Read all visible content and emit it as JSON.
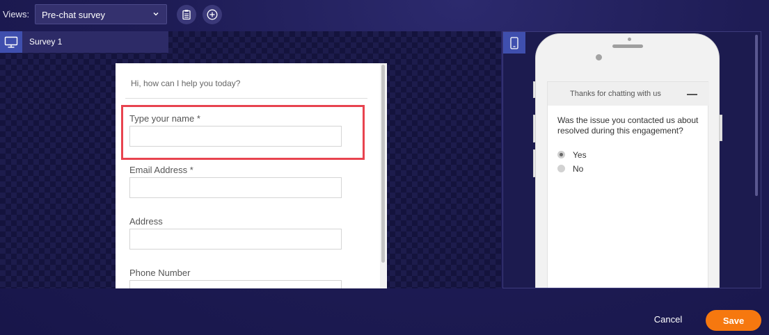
{
  "toolbar": {
    "views_label": "Views:",
    "views_selected": "Pre-chat survey"
  },
  "left_panel": {
    "tab_label": "Survey 1",
    "survey": {
      "greeting": "Hi, how can I help you today?",
      "fields": [
        {
          "label": "Type your name *"
        },
        {
          "label": "Email Address *"
        },
        {
          "label": "Address"
        },
        {
          "label": "Phone Number"
        }
      ]
    }
  },
  "right_panel": {
    "preview": {
      "header_title": "Thanks for chatting with us",
      "question": "Was the issue you contacted us about resolved during this engagement?",
      "options": [
        {
          "label": "Yes",
          "selected": true
        },
        {
          "label": "No",
          "selected": false
        }
      ]
    }
  },
  "footer": {
    "cancel_label": "Cancel",
    "save_label": "Save"
  },
  "colors": {
    "background": "#1e1c55",
    "accent_blue": "#3f4fae",
    "save_orange": "#f6780f",
    "highlight_red": "#e8434f"
  },
  "icons": {
    "template": "clipboard-icon",
    "add": "plus-circle-icon",
    "desktop": "monitor-icon",
    "mobile": "phone-icon",
    "dropdown": "chevron-down-icon"
  }
}
